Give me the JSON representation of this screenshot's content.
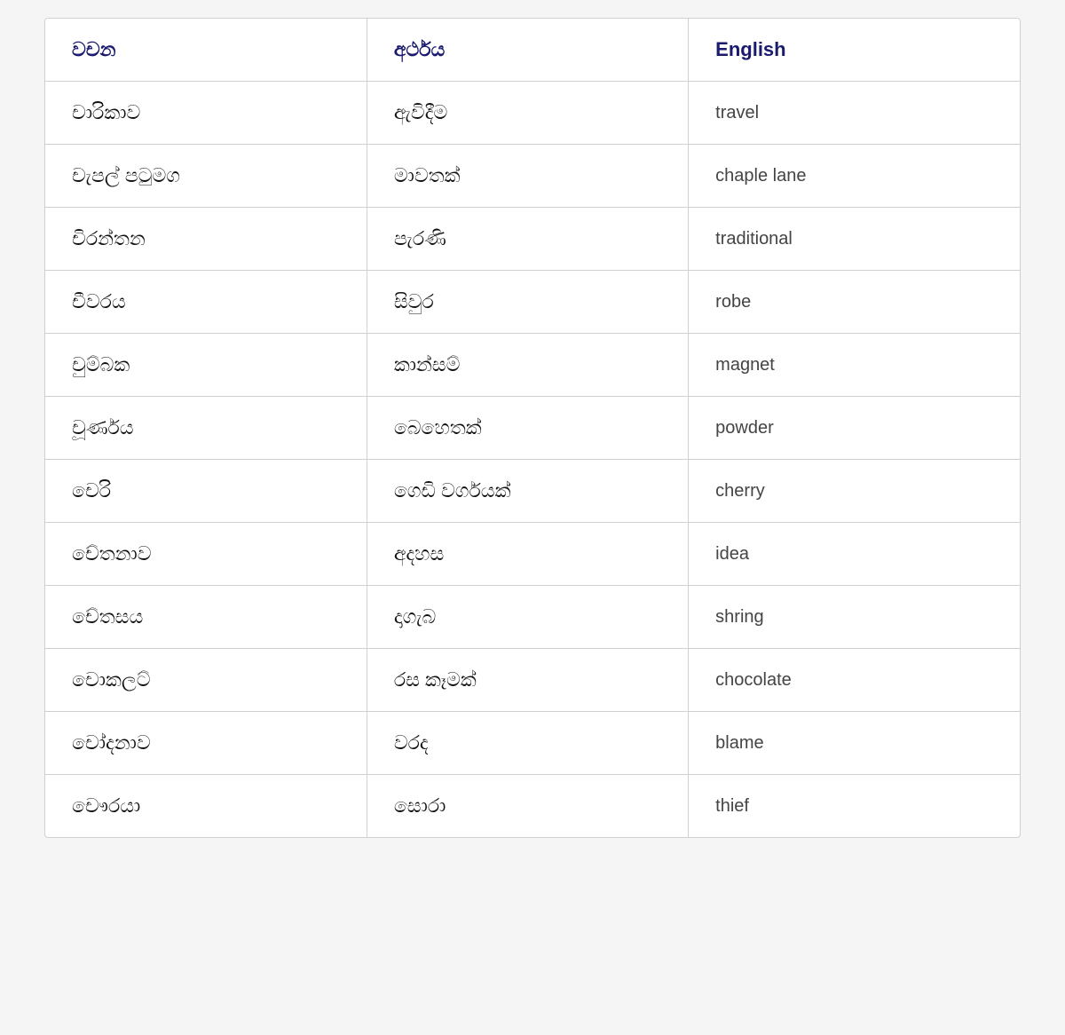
{
  "table": {
    "headers": {
      "col1": "වචන",
      "col2": "අර්ථය",
      "col3": "English"
    },
    "rows": [
      {
        "col1": "චාරිකාව",
        "col2": "ඇවිදීම",
        "col3": "travel"
      },
      {
        "col1": "චැපල් පටුමග",
        "col2": "මාවතක්",
        "col3": "chaple lane"
      },
      {
        "col1": "චිරන්තන",
        "col2": "පැරණි",
        "col3": "traditional"
      },
      {
        "col1": "චීවරය",
        "col2": "සිවුර",
        "col3": "robe"
      },
      {
        "col1": "චුම්බක",
        "col2": "කාන්සම්",
        "col3": "magnet"
      },
      {
        "col1": "චූර්ණය",
        "col2": "බෙහෙතක්",
        "col3": "powder"
      },
      {
        "col1": "චෙරි",
        "col2": "ගෙඩි වර්ගයක්",
        "col3": "cherry"
      },
      {
        "col1": "චේතනාව",
        "col2": "අදහස",
        "col3": "idea"
      },
      {
        "col1": "චේතසය",
        "col2": "දාගැබ",
        "col3": "shring"
      },
      {
        "col1": "චොකලට්",
        "col2": "රස කෑමක්",
        "col3": "chocolate"
      },
      {
        "col1": "චෝදනාව",
        "col2": "වරද",
        "col3": "blame"
      },
      {
        "col1": "චෞරයා",
        "col2": "සොරා",
        "col3": "thief"
      }
    ]
  }
}
